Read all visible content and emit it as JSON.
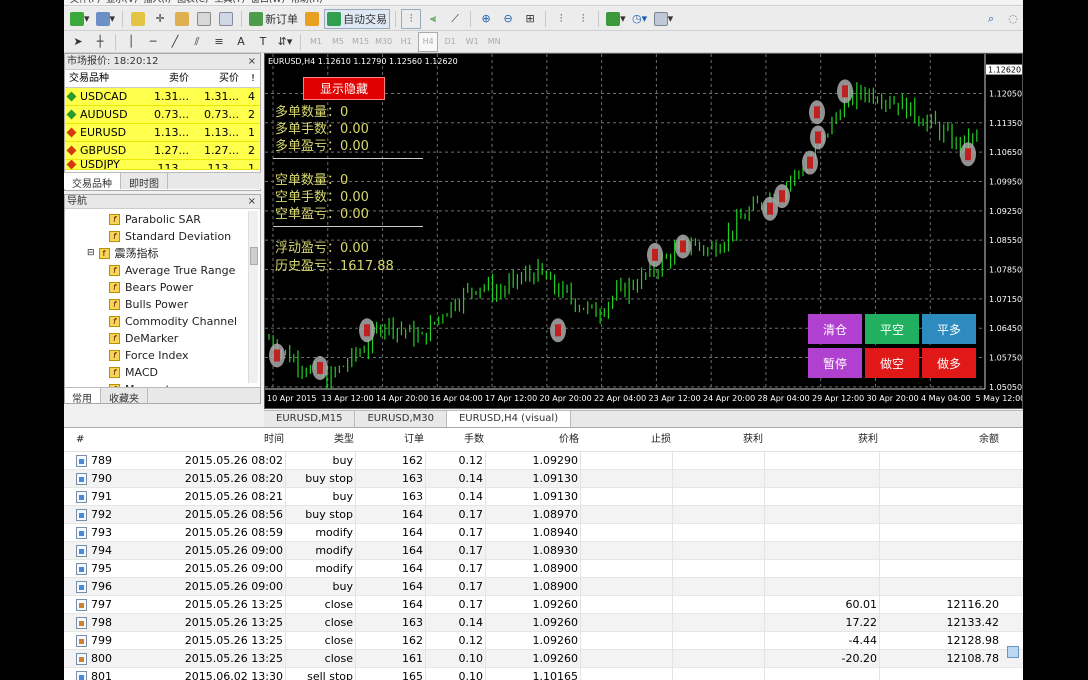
{
  "menu": {
    "item1": "文件(F)",
    "item2": "显示(V)",
    "item3": "插入(I)",
    "item4": "图表(C)",
    "item5": "工具(T)",
    "item6": "窗口(W)",
    "item7": "帮助(H)"
  },
  "toolbar": {
    "new_order": "新订单",
    "auto_trade": "自动交易"
  },
  "timeframes": [
    "M1",
    "M5",
    "M15",
    "M30",
    "H1",
    "H4",
    "D1",
    "W1",
    "MN"
  ],
  "market_watch": {
    "title": "市场报价: 18:20:12",
    "headers": {
      "symbol": "交易品种",
      "bid": "卖价",
      "ask": "买价"
    },
    "rows": [
      {
        "symbol": "USDCAD",
        "bid": "1.31...",
        "ask": "1.31...",
        "spread": "4",
        "dir": "up"
      },
      {
        "symbol": "AUDUSD",
        "bid": "0.73...",
        "ask": "0.73...",
        "spread": "2",
        "dir": "up"
      },
      {
        "symbol": "EURUSD",
        "bid": "1.13...",
        "ask": "1.13...",
        "spread": "1",
        "dir": "down"
      },
      {
        "symbol": "GBPUSD",
        "bid": "1.27...",
        "ask": "1.27...",
        "spread": "2",
        "dir": "down"
      },
      {
        "symbol": "USDJPY",
        "bid": "113...",
        "ask": "113...",
        "spread": "1",
        "dir": "down"
      }
    ],
    "tabs": {
      "symbols": "交易品种",
      "ticks": "即时图"
    }
  },
  "navigator": {
    "title": "导航",
    "items": [
      "Parabolic SAR",
      "Standard Deviation",
      "震荡指标",
      "Average True Range",
      "Bears Power",
      "Bulls Power",
      "Commodity Channel",
      "DeMarker",
      "Force Index",
      "MACD",
      "Momentum"
    ],
    "tabs": {
      "common": "常用",
      "favorites": "收藏夹"
    }
  },
  "chart": {
    "header": "EURUSD,H4  1.12610 1.12790 1.12560 1.12620",
    "show_hide": "显示隐藏",
    "long_count": "多单数量：0",
    "long_lots": "多单手数：0.00",
    "long_pl": "多单盈亏：0.00",
    "short_count": "空单数量：0",
    "short_lots": "空单手数：0.00",
    "short_pl": "空单盈亏：0.00",
    "float_pl": "浮动盈亏：0.00",
    "history_pl": "历史盈亏：1617.88",
    "buttons": {
      "clear": "清仓",
      "close_short": "平空",
      "close_long": "平多",
      "pause": "暂停",
      "do_short": "做空",
      "do_long": "做多"
    },
    "colors": {
      "clear": "#b040d0",
      "close_short": "#20b060",
      "close_long": "#2e8bc0",
      "pause": "#b040d0",
      "do_short": "#e01818",
      "do_long": "#e01818"
    }
  },
  "chart_data": {
    "type": "candlestick",
    "y_ticks": [
      "1.12620",
      "1.12050",
      "1.11350",
      "1.10650",
      "1.09950",
      "1.09250",
      "1.08550",
      "1.07850",
      "1.07150",
      "1.06450",
      "1.05750",
      "1.05050"
    ],
    "ylim": [
      1.05,
      1.128
    ],
    "x_ticks": [
      "10 Apr 2015",
      "13 Apr 12:00",
      "14 Apr 20:00",
      "16 Apr 04:00",
      "17 Apr 12:00",
      "20 Apr 20:00",
      "22 Apr 04:00",
      "23 Apr 12:00",
      "24 Apr 20:00",
      "28 Apr 04:00",
      "29 Apr 12:00",
      "30 Apr 20:00",
      "4 May 04:00",
      "5 May 12:00"
    ],
    "last_price": "1.12620"
  },
  "chart_tabs": [
    "EURUSD,M15",
    "EURUSD,M30",
    "EURUSD,H4 (visual)"
  ],
  "table": {
    "headers": {
      "num": "#",
      "time": "时间",
      "type": "类型",
      "order": "订单",
      "lots": "手数",
      "price": "价格",
      "sl": "止损",
      "tp": "获利",
      "profit": "获利",
      "balance": "余额"
    },
    "rows": [
      {
        "num": "789",
        "time": "2015.05.26 08:02",
        "type": "buy",
        "order": "162",
        "lots": "0.12",
        "price": "1.09290",
        "profit": "",
        "balance": ""
      },
      {
        "num": "790",
        "time": "2015.05.26 08:20",
        "type": "buy stop",
        "order": "163",
        "lots": "0.14",
        "price": "1.09130",
        "profit": "",
        "balance": ""
      },
      {
        "num": "791",
        "time": "2015.05.26 08:21",
        "type": "buy",
        "order": "163",
        "lots": "0.14",
        "price": "1.09130",
        "profit": "",
        "balance": ""
      },
      {
        "num": "792",
        "time": "2015.05.26 08:56",
        "type": "buy stop",
        "order": "164",
        "lots": "0.17",
        "price": "1.08970",
        "profit": "",
        "balance": ""
      },
      {
        "num": "793",
        "time": "2015.05.26 08:59",
        "type": "modify",
        "order": "164",
        "lots": "0.17",
        "price": "1.08940",
        "profit": "",
        "balance": ""
      },
      {
        "num": "794",
        "time": "2015.05.26 09:00",
        "type": "modify",
        "order": "164",
        "lots": "0.17",
        "price": "1.08930",
        "profit": "",
        "balance": ""
      },
      {
        "num": "795",
        "time": "2015.05.26 09:00",
        "type": "modify",
        "order": "164",
        "lots": "0.17",
        "price": "1.08900",
        "profit": "",
        "balance": ""
      },
      {
        "num": "796",
        "time": "2015.05.26 09:00",
        "type": "buy",
        "order": "164",
        "lots": "0.17",
        "price": "1.08900",
        "profit": "",
        "balance": ""
      },
      {
        "num": "797",
        "time": "2015.05.26 13:25",
        "type": "close",
        "order": "164",
        "lots": "0.17",
        "price": "1.09260",
        "profit": "60.01",
        "balance": "12116.20"
      },
      {
        "num": "798",
        "time": "2015.05.26 13:25",
        "type": "close",
        "order": "163",
        "lots": "0.14",
        "price": "1.09260",
        "profit": "17.22",
        "balance": "12133.42"
      },
      {
        "num": "799",
        "time": "2015.05.26 13:25",
        "type": "close",
        "order": "162",
        "lots": "0.12",
        "price": "1.09260",
        "profit": "-4.44",
        "balance": "12128.98"
      },
      {
        "num": "800",
        "time": "2015.05.26 13:25",
        "type": "close",
        "order": "161",
        "lots": "0.10",
        "price": "1.09260",
        "profit": "-20.20",
        "balance": "12108.78"
      },
      {
        "num": "801",
        "time": "2015.06.02 13:30",
        "type": "sell stop",
        "order": "165",
        "lots": "0.10",
        "price": "1.10165",
        "profit": "",
        "balance": ""
      }
    ]
  }
}
